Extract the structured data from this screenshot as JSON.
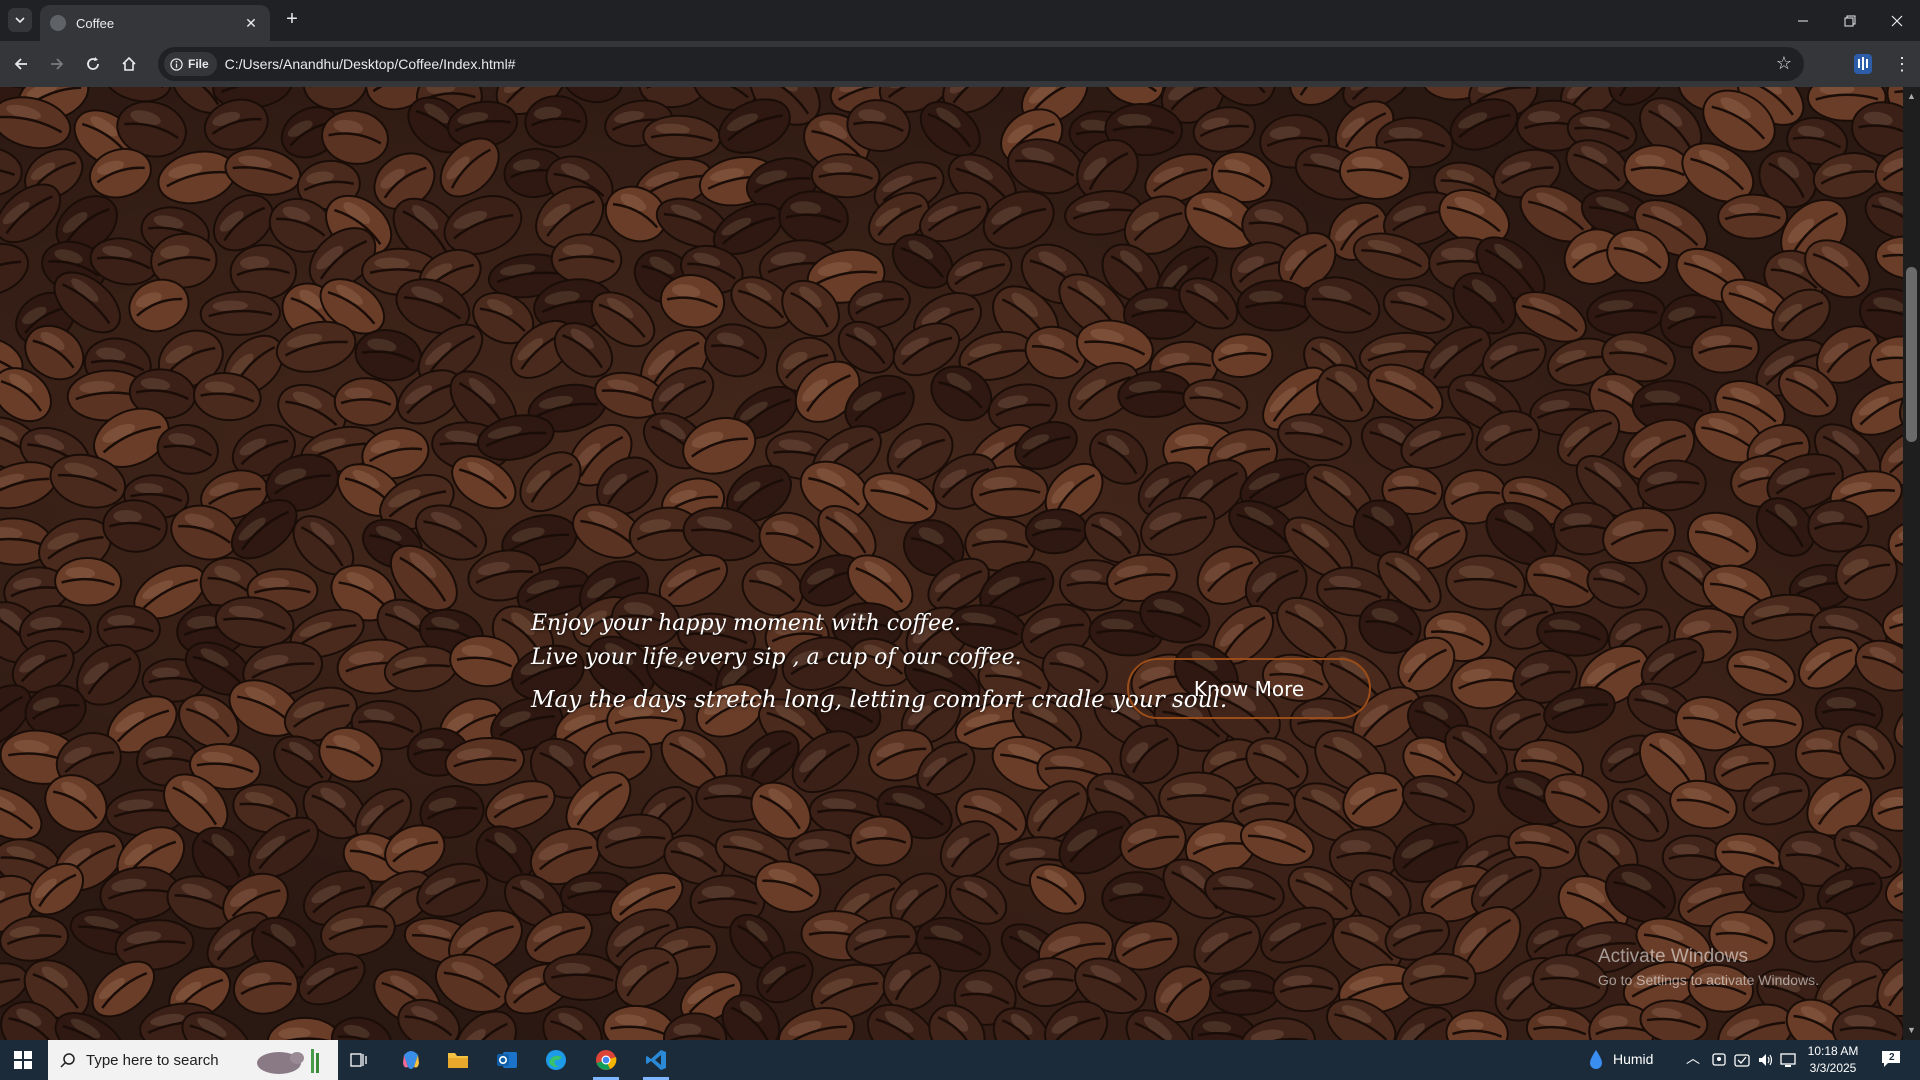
{
  "browser": {
    "tab_title": "Coffee",
    "close_tab": "✕",
    "new_tab": "+",
    "chip_label": "File",
    "url": "C:/Users/Anandhu/Desktop/Coffee/Index.html#"
  },
  "hero": {
    "line1": "Enjoy your happy moment with coffee.",
    "line2": "Live your life,every sip , a cup of our coffee.",
    "line3": "May the days stretch long, letting comfort cradle your soul.",
    "button_label": "Know More"
  },
  "watermark": {
    "title": "Activate Windows",
    "subtitle": "Go to Settings to activate Windows."
  },
  "taskbar": {
    "search_placeholder": "Type here to search",
    "weather": "Humid",
    "time": "10:18 AM",
    "date": "3/3/2025",
    "notifications": "2"
  },
  "colors": {
    "button_border": "#9a4d18",
    "page_bg": "#2a1812"
  }
}
